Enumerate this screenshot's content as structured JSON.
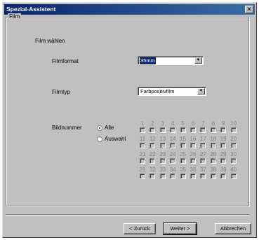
{
  "window": {
    "title": "Spezial-Assistent",
    "close_glyph": "✕"
  },
  "group": {
    "legend": "Film",
    "subtitle": "Film wählen"
  },
  "filmformat": {
    "label": "Filmformat",
    "value": "35mm",
    "arrow": "▼"
  },
  "filmtyp": {
    "label": "Filmtyp",
    "value": "Farbpositivfilm",
    "arrow": "▼"
  },
  "bildnummer": {
    "label": "Bildnummer",
    "options": [
      {
        "label": "Alle",
        "selected": true
      },
      {
        "label": "Auswahl",
        "selected": false
      }
    ],
    "rows": [
      [
        "1",
        "2",
        "3",
        "4",
        "5",
        "6",
        "7",
        "8",
        "9",
        "10"
      ],
      [
        "11",
        "12",
        "13",
        "14",
        "15",
        "16",
        "17",
        "18",
        "19",
        "20"
      ],
      [
        "21",
        "22",
        "23",
        "24",
        "25",
        "26",
        "27",
        "28",
        "29",
        "30"
      ],
      [
        "31",
        "32",
        "33",
        "34",
        "35",
        "36",
        "37",
        "38",
        "39",
        "40"
      ]
    ]
  },
  "buttons": {
    "back": "< Zurück",
    "next": "Weiter >",
    "cancel": "Abbrechen"
  }
}
